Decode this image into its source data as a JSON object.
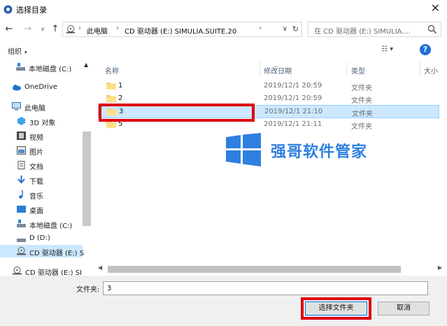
{
  "window": {
    "title": "选择目录",
    "close_glyph": "✕"
  },
  "nav": {
    "back_glyph": "←",
    "forward_glyph": "→",
    "recent_glyph": "∨",
    "up_glyph": "↑"
  },
  "address": {
    "crumbs": [
      "此电脑",
      "CD 驱动器 (E:) SIMULIA.SUITE.20"
    ],
    "separator": "›",
    "dropdown_glyph": "∨",
    "refresh_glyph": "↻"
  },
  "search": {
    "placeholder": "在 CD 驱动器 (E:) SIMULIA...."
  },
  "toolbar": {
    "organize_label": "组织",
    "organize_caret": "▾",
    "view_label": "☷ ▾",
    "help_label": "?"
  },
  "sidebar": {
    "items": [
      {
        "label": "本地磁盘 (C:)",
        "icon": "drive-icon"
      },
      {
        "label": "OneDrive",
        "icon": "onedrive-icon"
      },
      {
        "label": "此电脑",
        "icon": "pc-icon"
      },
      {
        "label": "3D 对象",
        "icon": "3d-objects-icon"
      },
      {
        "label": "视频",
        "icon": "video-icon"
      },
      {
        "label": "图片",
        "icon": "pictures-icon"
      },
      {
        "label": "文档",
        "icon": "documents-icon"
      },
      {
        "label": "下载",
        "icon": "downloads-icon"
      },
      {
        "label": "音乐",
        "icon": "music-icon"
      },
      {
        "label": "桌面",
        "icon": "desktop-icon"
      },
      {
        "label": "本地磁盘 (C:)",
        "icon": "drive-icon"
      },
      {
        "label": "D (D:)",
        "icon": "drive-icon"
      },
      {
        "label": "CD 驱动器 (E:) S",
        "icon": "cd-drive-icon"
      },
      {
        "label": "CD 驱动器 (E:) SI",
        "icon": "cd-drive-icon"
      }
    ]
  },
  "columns": {
    "name": "名称",
    "modified": "修改日期",
    "type": "类型",
    "size": "大小"
  },
  "files": [
    {
      "name": "1",
      "date": "2019/12/1 20:59",
      "type": "文件夹"
    },
    {
      "name": "2",
      "date": "2019/12/1 20:59",
      "type": "文件夹"
    },
    {
      "name": "3",
      "date": "2019/12/1 21:10",
      "type": "文件夹"
    },
    {
      "name": "5",
      "date": "2019/12/1 21:11",
      "type": "文件夹"
    }
  ],
  "watermark": {
    "text": "强哥软件管家",
    "color": "#2f7fe0"
  },
  "footer": {
    "folder_label": "文件夹:",
    "folder_value": "3",
    "select_button": "选择文件夹",
    "cancel_button": "取消"
  },
  "colors": {
    "selection": "#cce8ff",
    "highlight_box": "#e0000b",
    "accent": "#0078d7"
  }
}
